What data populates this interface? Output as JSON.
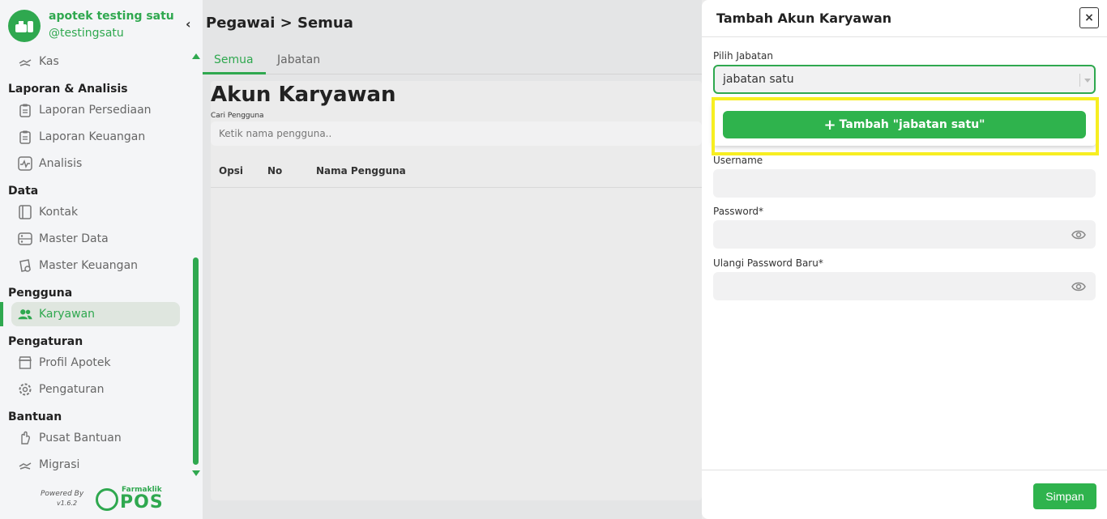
{
  "app": {
    "store_name": "apotek testing satu",
    "username": "@testingsatu",
    "collapse_icon": "chevron-left-icon"
  },
  "sidebar": {
    "items": [
      {
        "type": "item",
        "label": "Kas",
        "icon": "cash-icon"
      },
      {
        "type": "section",
        "label": "Laporan & Analisis"
      },
      {
        "type": "item",
        "label": "Laporan Persediaan",
        "icon": "clipboard-icon"
      },
      {
        "type": "item",
        "label": "Laporan Keuangan",
        "icon": "clipboard-icon"
      },
      {
        "type": "item",
        "label": "Analisis",
        "icon": "activity-icon"
      },
      {
        "type": "section",
        "label": "Data"
      },
      {
        "type": "item",
        "label": "Kontak",
        "icon": "contact-book-icon"
      },
      {
        "type": "item",
        "label": "Master Data",
        "icon": "database-icon"
      },
      {
        "type": "item",
        "label": "Master Keuangan",
        "icon": "finance-icon"
      },
      {
        "type": "section",
        "label": "Pengguna"
      },
      {
        "type": "item",
        "label": "Karyawan",
        "icon": "users-icon",
        "active": true
      },
      {
        "type": "section",
        "label": "Pengaturan"
      },
      {
        "type": "item",
        "label": "Profil Apotek",
        "icon": "store-icon"
      },
      {
        "type": "item",
        "label": "Pengaturan",
        "icon": "gear-icon"
      },
      {
        "type": "section",
        "label": "Bantuan"
      },
      {
        "type": "item",
        "label": "Pusat Bantuan",
        "icon": "hand-icon"
      },
      {
        "type": "item",
        "label": "Migrasi",
        "icon": "migrate-icon"
      }
    ],
    "footer": {
      "powered_by": "Powered By",
      "version": "v1.6.2",
      "brand_small": "Farmaklik",
      "brand_large": "POS"
    }
  },
  "main": {
    "breadcrumb": "Pegawai > Semua",
    "tabs": [
      {
        "label": "Semua",
        "active": true
      },
      {
        "label": "Jabatan",
        "active": false
      }
    ],
    "page_title": "Akun Karyawan",
    "search": {
      "label": "Cari Pengguna",
      "placeholder": "Ketik nama pengguna.."
    },
    "table": {
      "columns": [
        "Opsi",
        "No",
        "Nama Pengguna"
      ],
      "rows": []
    }
  },
  "modal": {
    "title": "Tambah Akun Karyawan",
    "close_label": "×",
    "jabatan": {
      "label": "Pilih Jabatan",
      "value": "jabatan satu",
      "add_option_label": "Tambah \"jabatan satu\""
    },
    "username": {
      "label": "Username",
      "value": ""
    },
    "password": {
      "label": "Password*",
      "value": ""
    },
    "confirm_password": {
      "label": "Ulangi Password Baru*",
      "value": ""
    },
    "save_label": "Simpan"
  },
  "colors": {
    "brand": "#2fa84f",
    "highlight": "#f7ee21"
  }
}
